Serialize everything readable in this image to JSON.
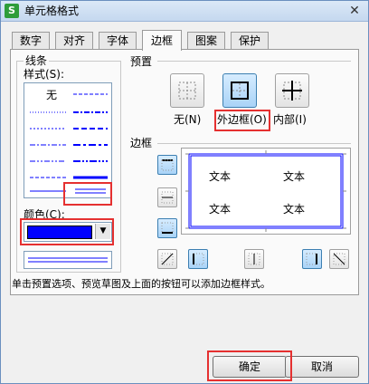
{
  "window": {
    "title": "单元格格式",
    "app_icon_letter": "S",
    "close_glyph": "✕"
  },
  "tabs": [
    {
      "label": "数字"
    },
    {
      "label": "对齐"
    },
    {
      "label": "字体"
    },
    {
      "label": "边框",
      "active": true
    },
    {
      "label": "图案"
    },
    {
      "label": "保护"
    }
  ],
  "line_group": {
    "title": "线条",
    "style_label": "样式(S):",
    "none_label": "无",
    "color_label": "颜色(C):",
    "selected_color": "#0000ff"
  },
  "preset_group": {
    "title": "预置",
    "items": [
      {
        "label": "无(N)"
      },
      {
        "label": "外边框(O)"
      },
      {
        "label": "内部(I)"
      }
    ]
  },
  "border_group": {
    "title": "边框",
    "preview_cells": [
      "文本",
      "文本",
      "文本",
      "文本"
    ]
  },
  "hint": "单击预置选项、预览草图及上面的按钮可以添加边框样式。",
  "buttons": {
    "ok": "确定",
    "cancel": "取消"
  },
  "colors": {
    "highlight": "#e53030",
    "accent": "#0000ff",
    "selected_button": "#a9d3f7"
  }
}
